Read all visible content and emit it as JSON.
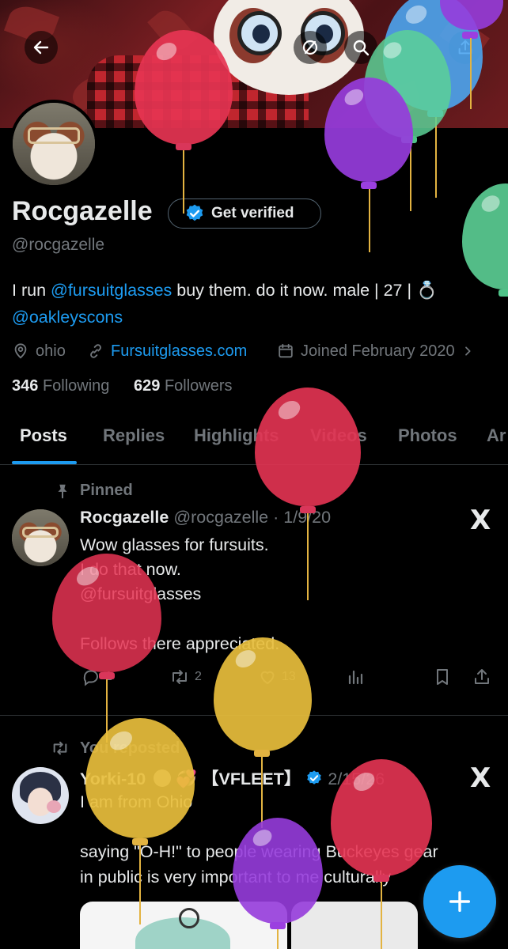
{
  "header": {
    "back_icon": "arrow-left-icon",
    "search_icon": "search-icon",
    "no_sign_icon": "circle-slash-icon"
  },
  "profile": {
    "display_name": "Rocgazelle",
    "get_verified_label": "Get verified",
    "handle": "@rocgazelle",
    "bio": {
      "prefix": "I run ",
      "mention1": "@fursuitglasses",
      "middle": " buy them. do it now. male | 27 | ",
      "ring_icon": "💍",
      "mention2": "@oakleyscons"
    },
    "location": "ohio",
    "website": "Fursuitglasses.com",
    "joined": "Joined February 2020",
    "following_count": "346",
    "following_label": "Following",
    "followers_count": "629",
    "followers_label": "Followers"
  },
  "tabs": [
    {
      "label": "Posts",
      "active": true
    },
    {
      "label": "Replies",
      "active": false
    },
    {
      "label": "Highlights",
      "active": false
    },
    {
      "label": "Videos",
      "active": false
    },
    {
      "label": "Photos",
      "active": false
    },
    {
      "label": "Ar",
      "active": false
    }
  ],
  "posts": [
    {
      "context": "Pinned",
      "author": "Rocgazelle",
      "handle": "@rocgazelle",
      "separator": "·",
      "date": "1/9/20",
      "lines": [
        "Wow glasses for fursuits.",
        "I do that now.",
        "@fursuitglasses",
        "",
        "Follows there appreciated."
      ],
      "replies": "1",
      "reposts": "2",
      "likes": "13",
      "x_logo": "X"
    },
    {
      "context": "You reposted",
      "author": "Yorki-10",
      "author_emoji": "💞",
      "author_tag": "【VFLEET】",
      "date": "2/15/26",
      "lines": [
        "I am from Ohio",
        "",
        "saying \"O-H!\" to people wearing Buckeyes gear",
        "in public is very important to me culturally"
      ],
      "x_logo": "X"
    }
  ],
  "fab_label": "+",
  "colors": {
    "accent": "#1d9bf0",
    "text": "#e7e9ea",
    "muted": "#71767b",
    "background": "#000000",
    "divider": "#2f3336"
  }
}
